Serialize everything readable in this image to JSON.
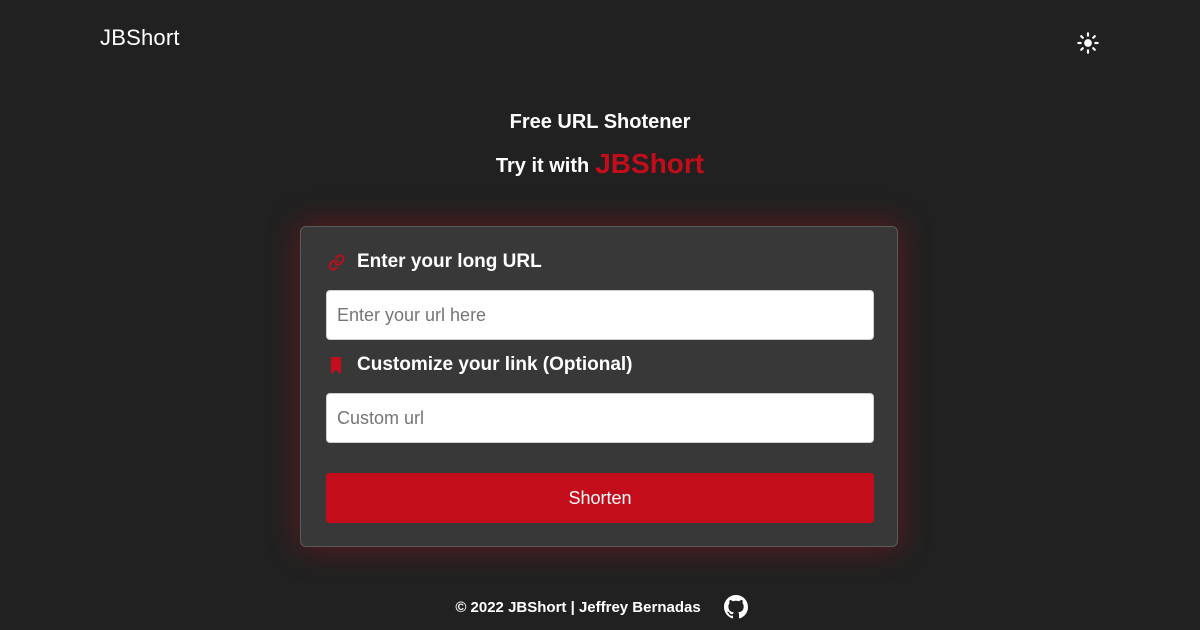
{
  "header": {
    "brand": "JBShort",
    "theme_toggle_icon": "sun-icon"
  },
  "hero": {
    "title": "Free URL Shotener",
    "subtitle_prefix": "Try it with",
    "subtitle_brand": "JBShort"
  },
  "form": {
    "long_url": {
      "icon": "link-icon",
      "label": "Enter your long URL",
      "placeholder": "Enter your url here",
      "value": ""
    },
    "custom": {
      "icon": "bookmark-icon",
      "label": "Customize your link (Optional)",
      "placeholder": "Custom url",
      "value": ""
    },
    "submit_label": "Shorten"
  },
  "footer": {
    "text": "© 2022 JBShort | Jeffrey Bernadas",
    "github_icon": "github-icon"
  },
  "colors": {
    "background": "#212121",
    "card_background": "#383838",
    "accent": "#c40d1b",
    "text": "#ffffff"
  }
}
